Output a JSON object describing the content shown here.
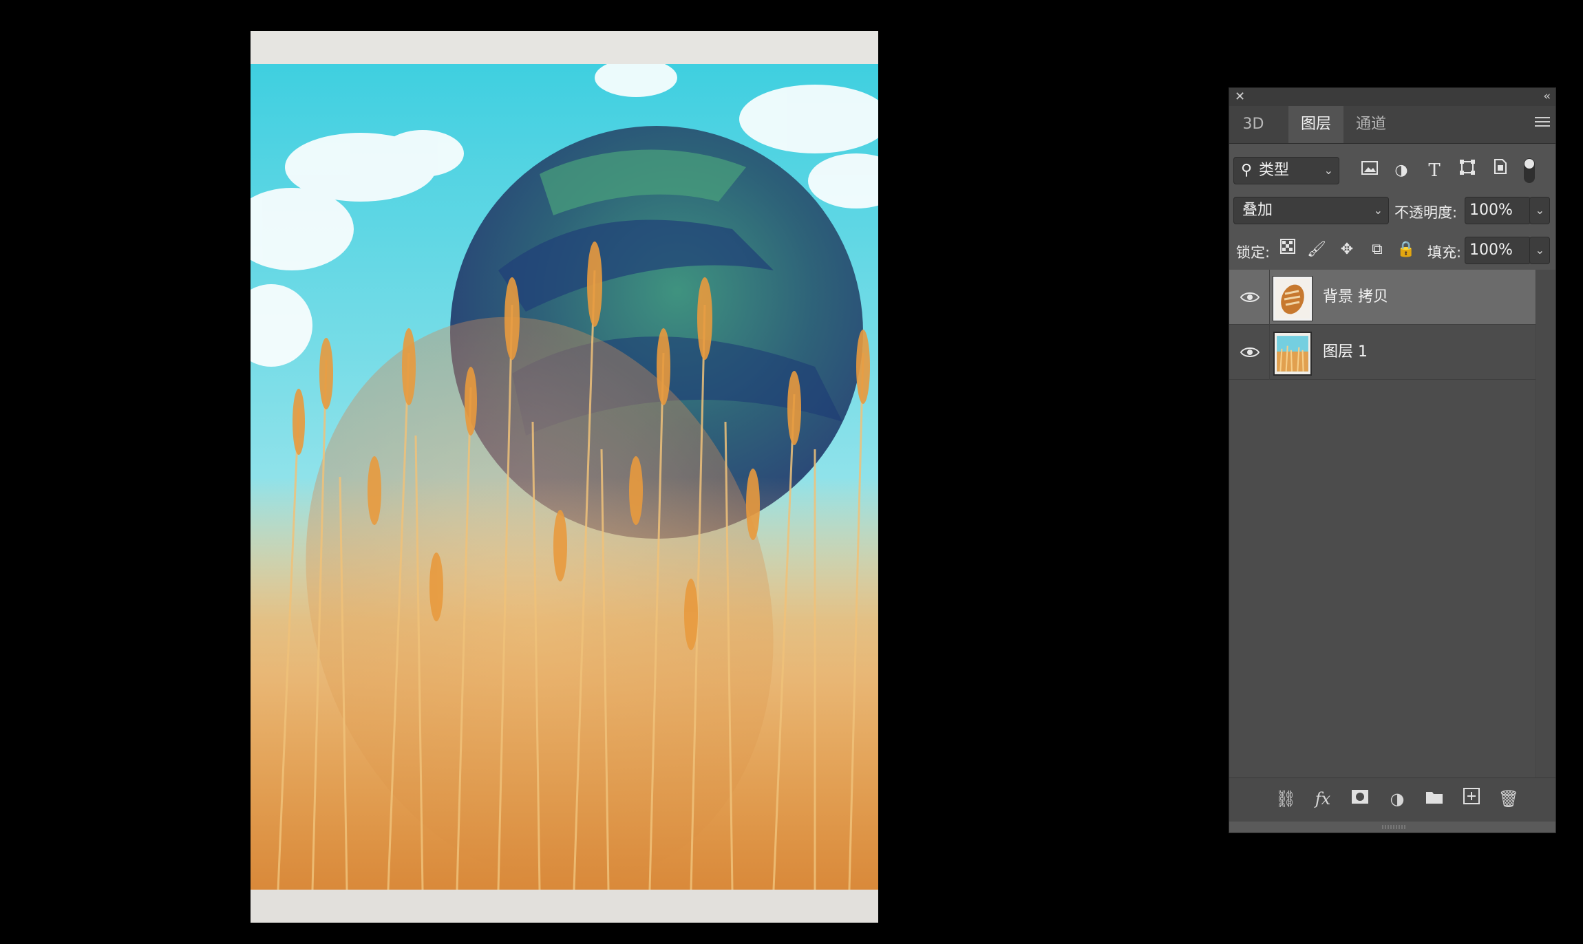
{
  "panel": {
    "tabs": [
      {
        "label": "3D",
        "active": false
      },
      {
        "label": "图层",
        "active": true
      },
      {
        "label": "通道",
        "active": false
      }
    ],
    "filter": {
      "kind_label": "类型",
      "icons": [
        "image-filter-icon",
        "adjustment-filter-icon",
        "type-filter-icon",
        "shape-filter-icon",
        "smart-object-filter-icon"
      ]
    },
    "blend_mode": "叠加",
    "opacity_label": "不透明度:",
    "opacity_value": "100%",
    "lock_label": "锁定:",
    "fill_label": "填充:",
    "fill_value": "100%",
    "layers": [
      {
        "name": "背景 拷贝",
        "visible": true,
        "selected": true,
        "thumb": "bread"
      },
      {
        "name": "图层 1",
        "visible": true,
        "selected": false,
        "thumb": "wheat-field"
      }
    ],
    "footer_icons": [
      "link-layers-icon",
      "fx-icon",
      "layer-mask-icon",
      "adjustment-layer-icon",
      "group-folder-icon",
      "new-layer-icon",
      "delete-layer-icon"
    ]
  },
  "colors": {
    "panel_bg": "#535353",
    "selected_row": "#6b6b6b",
    "sky": "#5fd3e0",
    "wheat": "#e0a24a",
    "globe_green": "#2f7f6a",
    "globe_blue": "#2c3f7a"
  }
}
